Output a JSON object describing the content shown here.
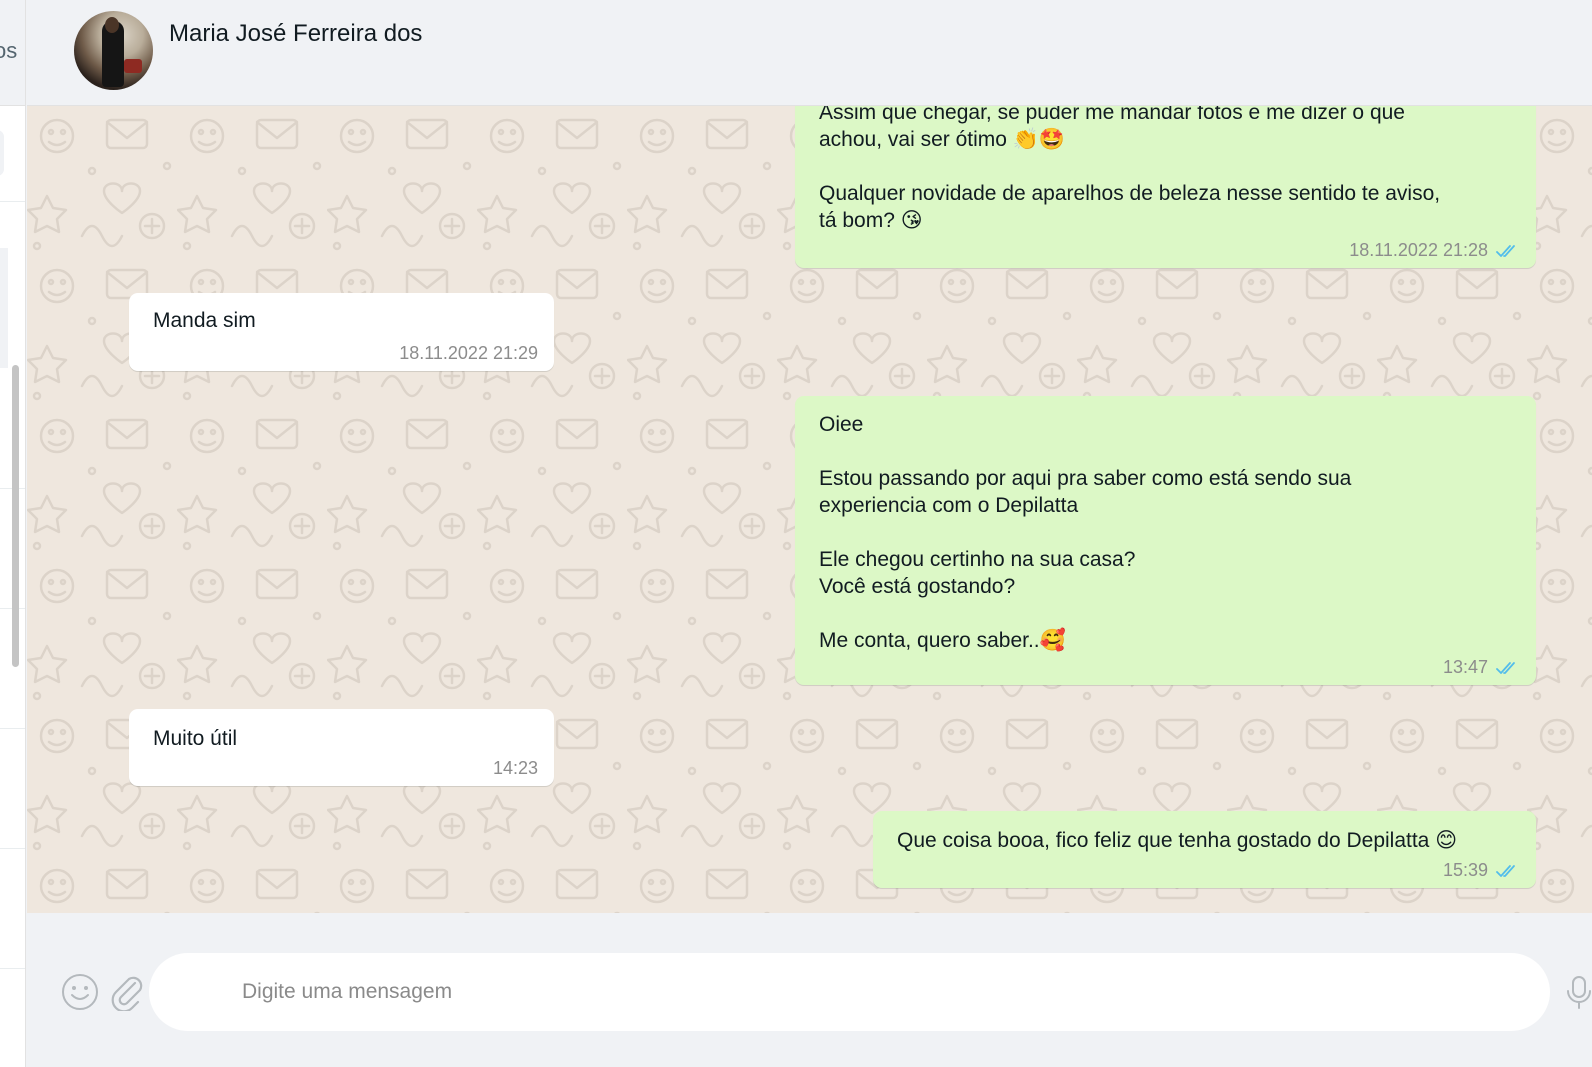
{
  "sidebar": {
    "cut_text": "os"
  },
  "header": {
    "contact_name": "Maria José Ferreira dos"
  },
  "messages": [
    {
      "direction": "outgoing",
      "text": "Assim que chegar, se puder me mandar fotos e me dizer o que\nachou, vai ser ótimo 👏🤩\n\nQualquer novidade de aparelhos de beleza nesse sentido te aviso,\ntá bom? 😘",
      "time": "18.11.2022 21:28",
      "status": "read"
    },
    {
      "direction": "incoming",
      "text": "Manda sim",
      "time": "18.11.2022 21:29"
    },
    {
      "direction": "outgoing",
      "text": "Oiee\n\nEstou passando por aqui pra saber como está sendo sua\nexperiencia com o Depilatta\n\nEle chegou certinho na sua casa?\nVocê está gostando?\n\nMe conta, quero saber..🥰",
      "time": "13:47",
      "status": "read"
    },
    {
      "direction": "incoming",
      "text": "Muito útil",
      "time": "14:23"
    },
    {
      "direction": "outgoing",
      "text": "Que coisa booa, fico feliz que tenha gostado do Depilatta 😊",
      "time": "15:39",
      "status": "read"
    }
  ],
  "footer": {
    "input_placeholder": "Digite uma mensagem",
    "input_value": ""
  },
  "icons": {
    "emoji": "smiley-icon",
    "attach": "paperclip-icon",
    "mic": "microphone-icon",
    "read_receipt": "double-check-icon"
  },
  "colors": {
    "outgoing_bubble": "#dcf8c6",
    "incoming_bubble": "#ffffff",
    "chat_background": "#efe7de",
    "read_tick": "#53bdeb",
    "panel": "#f0f2f5"
  }
}
